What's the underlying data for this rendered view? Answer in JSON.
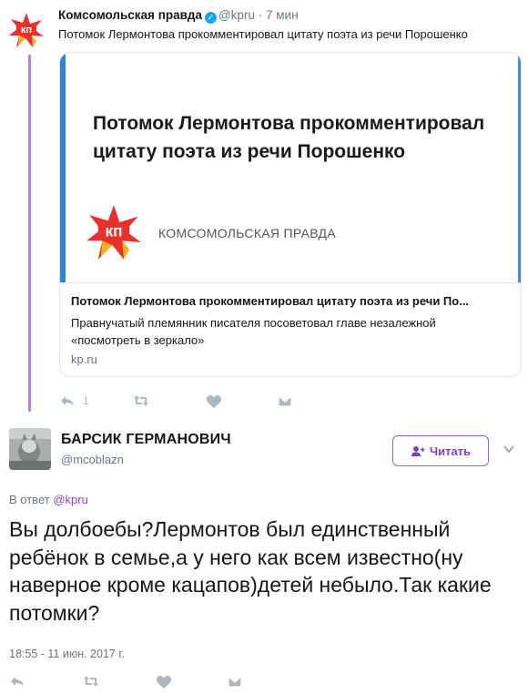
{
  "original_tweet": {
    "author_name": "Комсомольская правда",
    "verified_mark": "✓",
    "handle": "@kpru",
    "separator": "·",
    "time": "7 мин",
    "text": "Потомок Лермонтова прокомментировал цитату поэта из речи Порошенко",
    "card": {
      "image_headline": "Потомок Лермонтова прокомментировал цитату поэта из речи Порошенко",
      "image_brand": "КОМСОМОЛЬСКАЯ ПРАВДА",
      "title": "Потомок Лермонтова прокомментировал цитату поэта из речи По...",
      "description": "Правнучатый племянник писателя посоветовал главе незалежной «посмотреть в зеркало»",
      "domain": "kp.ru"
    },
    "actions": {
      "reply_count": "1",
      "retweet_count": "",
      "like_count": ""
    },
    "logo_text": "кп"
  },
  "reply_tweet": {
    "author_name": "БАРСИК ГЕРМАНОВИЧ",
    "handle": "@mcoblazn",
    "follow_label": "Читать",
    "reply_to_prefix": "В ответ",
    "reply_to_handle": "@kpru",
    "text": "Вы долбоебы?Лермонтов был единственный ребёнок в семье,а у него как всем известно(ну наверное кроме кацапов)детей небыло.Так какие потомки?",
    "timestamp": "18:55 - 11 июн. 2017 г."
  },
  "colors": {
    "accent_purple": "#8a45c9",
    "thread_line": "#b681e6",
    "verified_blue": "#1da1f2",
    "muted": "#657786",
    "icon_gray": "#aab8c2"
  },
  "icons": [
    "reply-icon",
    "retweet-icon",
    "heart-icon",
    "dm-icon",
    "follow-icon",
    "chevron-down-icon",
    "verified-icon"
  ]
}
